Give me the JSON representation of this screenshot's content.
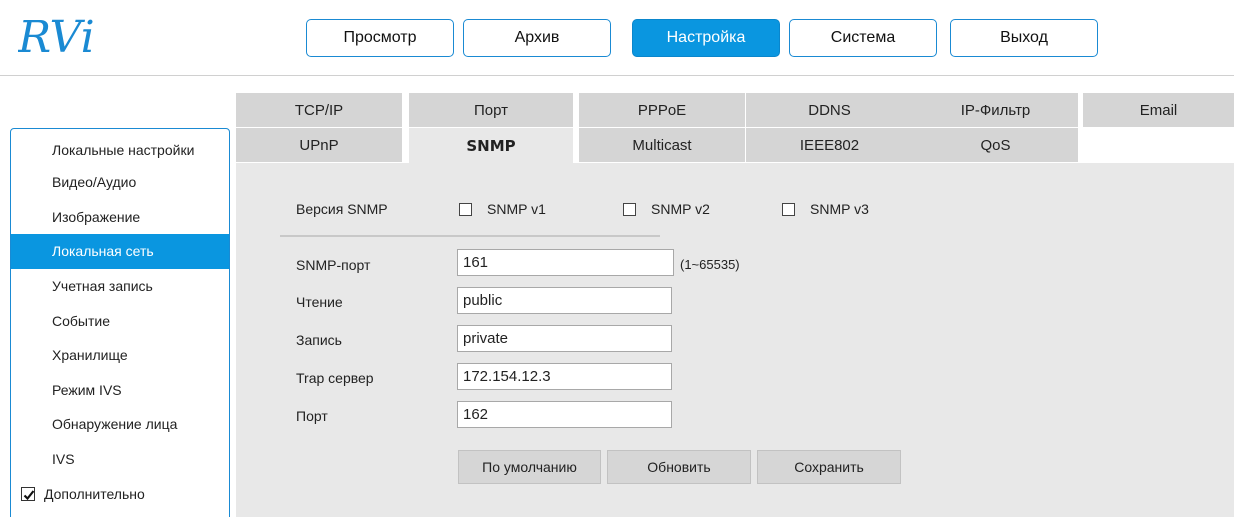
{
  "logo": {
    "text": "RVi",
    "color": "#1a8ad3"
  },
  "topnav": {
    "items": [
      {
        "label": "Просмотр",
        "active": false
      },
      {
        "label": "Архив",
        "active": false
      },
      {
        "label": "Настройка",
        "active": true
      },
      {
        "label": "Система",
        "active": false
      },
      {
        "label": "Выход",
        "active": false
      }
    ]
  },
  "sidebar": {
    "items": [
      {
        "label": "Локальные настройки"
      },
      {
        "label": "Видео/Аудио"
      },
      {
        "label": "Изображение"
      },
      {
        "label": "Локальная сеть",
        "active": true
      },
      {
        "label": "Учетная запись"
      },
      {
        "label": "Событие"
      },
      {
        "label": "Хранилище"
      },
      {
        "label": "Режим IVS"
      },
      {
        "label": "Обнаружение лица"
      },
      {
        "label": "IVS"
      },
      {
        "label": "Дополнительно",
        "checked": true
      }
    ]
  },
  "tabs": {
    "row1": [
      "TCP/IP",
      "Порт",
      "PPPoE",
      "DDNS",
      "IP-Фильтр",
      "Email"
    ],
    "row2": [
      "UPnP",
      "SNMP",
      "Multicast",
      "IEEE802",
      "QoS"
    ],
    "active": "SNMP"
  },
  "snmp": {
    "version_label": "Версия SNMP",
    "versions": [
      {
        "label": "SNMP v1",
        "checked": false
      },
      {
        "label": "SNMP v2",
        "checked": false
      },
      {
        "label": "SNMP v3",
        "checked": false
      }
    ],
    "port_label": "SNMP-порт",
    "port_value": "161",
    "port_range": "(1~65535)",
    "read_label": "Чтение",
    "read_value": "public",
    "write_label": "Запись",
    "write_value": "private",
    "trap_label": "Trap сервер",
    "trap_value": "172.154.12.3",
    "trap_port_label": "Порт",
    "trap_port_value": "162"
  },
  "buttons": {
    "default_label": "По умолчанию",
    "refresh_label": "Обновить",
    "save_label": "Сохранить"
  },
  "colors": {
    "accent": "#0a96e0",
    "panel": "#e8e8e8",
    "tab": "#d5d5d5"
  }
}
